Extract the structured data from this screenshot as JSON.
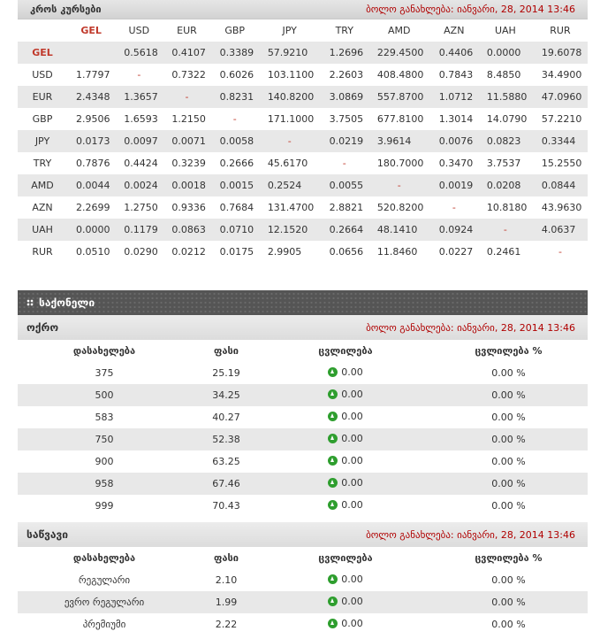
{
  "cross": {
    "title": "კროს კურსები",
    "updated": "ბოლო განახლება: იანვარი, 28, 2014 13:46",
    "columns": [
      "GEL",
      "USD",
      "EUR",
      "GBP",
      "JPY",
      "TRY",
      "AMD",
      "AZN",
      "UAH",
      "RUR"
    ],
    "rows": [
      {
        "code": "GEL",
        "vals": [
          "",
          "0.5618",
          "0.4107",
          "0.3389",
          "57.9210",
          "1.2696",
          "229.4500",
          "0.4406",
          "0.0000",
          "19.6078"
        ]
      },
      {
        "code": "USD",
        "vals": [
          "1.7797",
          "-",
          "0.7322",
          "0.6026",
          "103.1100",
          "2.2603",
          "408.4800",
          "0.7843",
          "8.4850",
          "34.4900"
        ]
      },
      {
        "code": "EUR",
        "vals": [
          "2.4348",
          "1.3657",
          "-",
          "0.8231",
          "140.8200",
          "3.0869",
          "557.8700",
          "1.0712",
          "11.5880",
          "47.0960"
        ]
      },
      {
        "code": "GBP",
        "vals": [
          "2.9506",
          "1.6593",
          "1.2150",
          "-",
          "171.1000",
          "3.7505",
          "677.8100",
          "1.3014",
          "14.0790",
          "57.2210"
        ]
      },
      {
        "code": "JPY",
        "vals": [
          "0.0173",
          "0.0097",
          "0.0071",
          "0.0058",
          "-",
          "0.0219",
          "3.9614",
          "0.0076",
          "0.0823",
          "0.3344"
        ]
      },
      {
        "code": "TRY",
        "vals": [
          "0.7876",
          "0.4424",
          "0.3239",
          "0.2666",
          "45.6170",
          "-",
          "180.7000",
          "0.3470",
          "3.7537",
          "15.2550"
        ]
      },
      {
        "code": "AMD",
        "vals": [
          "0.0044",
          "0.0024",
          "0.0018",
          "0.0015",
          "0.2524",
          "0.0055",
          "-",
          "0.0019",
          "0.0208",
          "0.0844"
        ]
      },
      {
        "code": "AZN",
        "vals": [
          "2.2699",
          "1.2750",
          "0.9336",
          "0.7684",
          "131.4700",
          "2.8821",
          "520.8200",
          "-",
          "10.8180",
          "43.9630"
        ]
      },
      {
        "code": "UAH",
        "vals": [
          "0.0000",
          "0.1179",
          "0.0863",
          "0.0710",
          "12.1520",
          "0.2664",
          "48.1410",
          "0.0924",
          "-",
          "4.0637"
        ]
      },
      {
        "code": "RUR",
        "vals": [
          "0.0510",
          "0.0290",
          "0.0212",
          "0.0175",
          "2.9905",
          "0.0656",
          "11.8460",
          "0.0227",
          "0.2461",
          "-"
        ]
      }
    ]
  },
  "goods": {
    "title": "საქონელი",
    "gold": {
      "title": "ოქრო",
      "updated": "ბოლო განახლება: იანვარი, 28, 2014 13:46",
      "headers": [
        "დასახელება",
        "ფასი",
        "ცვლილება",
        "ცვლილება %"
      ],
      "rows": [
        {
          "name": "375",
          "price": "25.19",
          "change": "0.00",
          "pct": "0.00 %"
        },
        {
          "name": "500",
          "price": "34.25",
          "change": "0.00",
          "pct": "0.00 %"
        },
        {
          "name": "583",
          "price": "40.27",
          "change": "0.00",
          "pct": "0.00 %"
        },
        {
          "name": "750",
          "price": "52.38",
          "change": "0.00",
          "pct": "0.00 %"
        },
        {
          "name": "900",
          "price": "63.25",
          "change": "0.00",
          "pct": "0.00 %"
        },
        {
          "name": "958",
          "price": "67.46",
          "change": "0.00",
          "pct": "0.00 %"
        },
        {
          "name": "999",
          "price": "70.43",
          "change": "0.00",
          "pct": "0.00 %"
        }
      ]
    },
    "fuel": {
      "title": "საწვავი",
      "updated": "ბოლო განახლება: იანვარი, 28, 2014 13:46",
      "headers": [
        "დასახელება",
        "ფასი",
        "ცვლილება",
        "ცვლილება %"
      ],
      "rows": [
        {
          "name": "რეგულარი",
          "price": "2.10",
          "change": "0.00",
          "pct": "0.00 %"
        },
        {
          "name": "ევრო რეგულარი",
          "price": "1.99",
          "change": "0.00",
          "pct": "0.00 %"
        },
        {
          "name": "პრემიუმი",
          "price": "2.22",
          "change": "0.00",
          "pct": "0.00 %"
        }
      ]
    }
  },
  "colors": {
    "accent": "#c0392b",
    "updated": "#b00000",
    "header_dark": "#555555",
    "row_alt": "#e8e8e8",
    "up_icon": "#2e9e2e"
  }
}
